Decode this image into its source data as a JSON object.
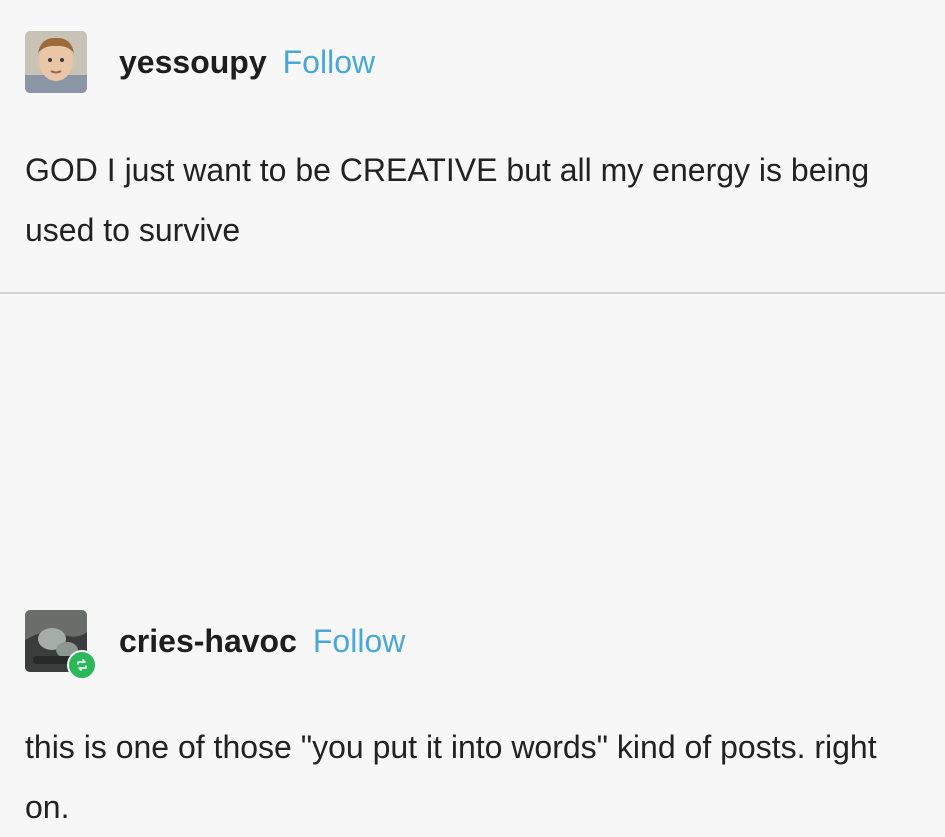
{
  "posts": [
    {
      "username": "yessoupy",
      "follow_label": "Follow",
      "text": "GOD I just want to be CREATIVE but all my energy is being used to survive",
      "avatar_icon": "child-portrait-icon"
    },
    {
      "username": "cries-havoc",
      "follow_label": "Follow",
      "text": "this is one of those \"you put it into words\" kind of posts. right on.",
      "avatar_icon": "avatar-photo-icon",
      "badge_icon": "reblog-icon",
      "badge_color": "#2cb85a"
    }
  ],
  "colors": {
    "follow": "#4aa8d8",
    "background": "#f7f7f7",
    "divider": "#d4d4d4"
  }
}
